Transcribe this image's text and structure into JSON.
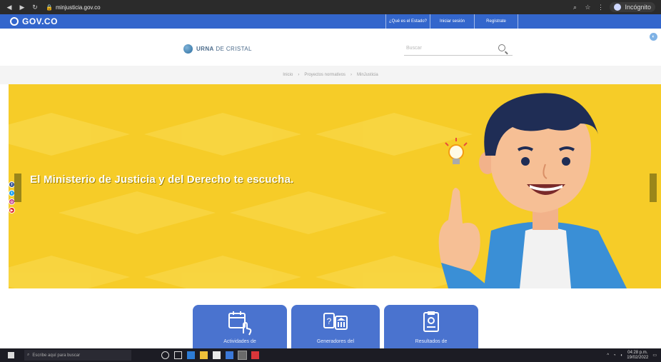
{
  "browser": {
    "url": "minjusticia.gov.co",
    "profile_label": "Incógnito"
  },
  "govbar": {
    "logo": "GOV.CO",
    "links": [
      "¿Qué es el Estado?",
      "Iniciar sesión",
      "Regístrate"
    ]
  },
  "header": {
    "logo_bold": "URNA",
    "logo_rest": "DE CRISTAL",
    "search_placeholder": "Buscar"
  },
  "breadcrumbs": [
    "Inicio",
    "Proyectos normativos",
    "MinJusticia"
  ],
  "hero": {
    "headline": "El Ministerio de Justicia y del Derecho te escucha."
  },
  "cards": [
    {
      "label": "Actividades de"
    },
    {
      "label": "Generadores del"
    },
    {
      "label": "Resultados de"
    }
  ],
  "taskbar": {
    "search_placeholder": "Escribe aquí para buscar",
    "time": "04:28 p.m.",
    "date": "19/02/2022"
  },
  "colors": {
    "gov_blue": "#3366cc",
    "hero_yellow": "#f6cc28",
    "card_blue": "#4a73cf"
  }
}
